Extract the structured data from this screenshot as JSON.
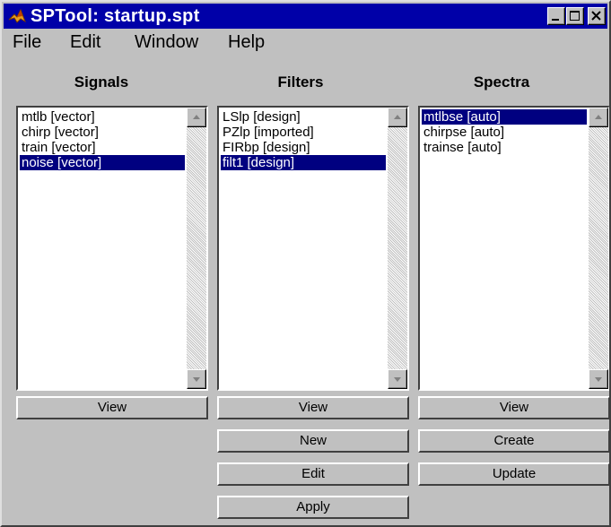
{
  "window": {
    "title": "SPTool: startup.spt",
    "controls": {
      "minimize": "minimize-icon",
      "maximize": "maximize-icon",
      "close": "close-icon"
    }
  },
  "menu": [
    "File",
    "Edit",
    "Window",
    "Help"
  ],
  "columns": {
    "signals": {
      "header": "Signals",
      "items": [
        "mtlb [vector]",
        "chirp [vector]",
        "train [vector]",
        "noise [vector]"
      ],
      "selected_index": 3,
      "buttons": [
        "View"
      ]
    },
    "filters": {
      "header": "Filters",
      "items": [
        "LSlp [design]",
        "PZlp [imported]",
        "FIRbp [design]",
        "filt1 [design]"
      ],
      "selected_index": 3,
      "buttons": [
        "View",
        "New",
        "Edit",
        "Apply"
      ]
    },
    "spectra": {
      "header": "Spectra",
      "items": [
        "mtlbse [auto]",
        "chirpse [auto]",
        "trainse [auto]"
      ],
      "selected_index": 0,
      "buttons": [
        "View",
        "Create",
        "Update"
      ]
    }
  },
  "colors": {
    "title_bar": "#0000a8",
    "selection": "#000080",
    "face": "#c0c0c0"
  }
}
